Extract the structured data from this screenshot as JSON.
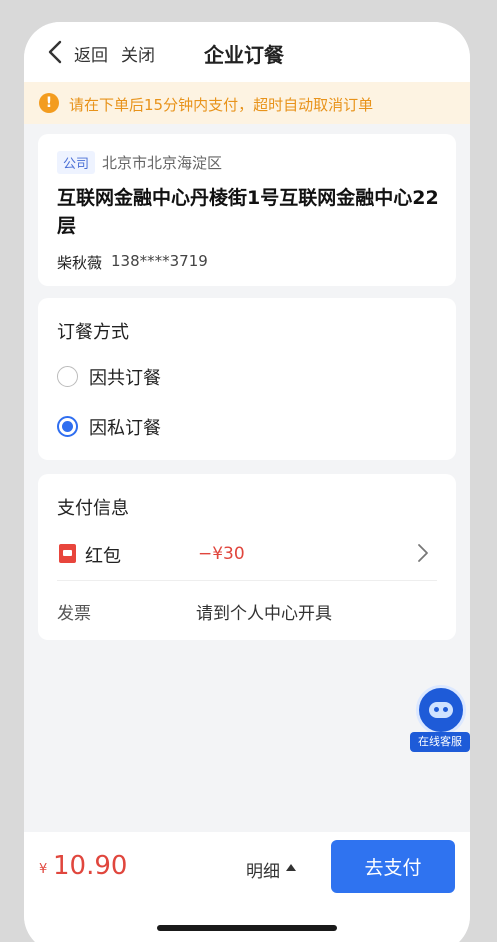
{
  "nav": {
    "back_label": "返回",
    "close_label": "关闭",
    "title": "企业订餐"
  },
  "notice": {
    "text": "请在下单后15分钟内支付，超时自动取消订单",
    "icon": "!"
  },
  "address": {
    "tag": "公司",
    "district": "北京市北京海淀区",
    "detail": "互联网金融中心丹棱街1号互联网金融中心22层",
    "name": "柴秋薇",
    "phone": "138****3719"
  },
  "order_method": {
    "title": "订餐方式",
    "options": [
      {
        "label": "因共订餐",
        "selected": false
      },
      {
        "label": "因私订餐",
        "selected": true
      }
    ]
  },
  "payment": {
    "title": "支付信息",
    "redpack_label": "红包",
    "redpack_value": "−¥30",
    "invoice_label": "发票",
    "invoice_value": "请到个人中心开具"
  },
  "service": {
    "label": "在线客服"
  },
  "bottom": {
    "currency": "¥",
    "total": "10.90",
    "detail_label": "明细",
    "pay_label": "去支付"
  },
  "colors": {
    "accent": "#2f73f0",
    "price": "#e0463d",
    "warning": "#f39c1f"
  }
}
